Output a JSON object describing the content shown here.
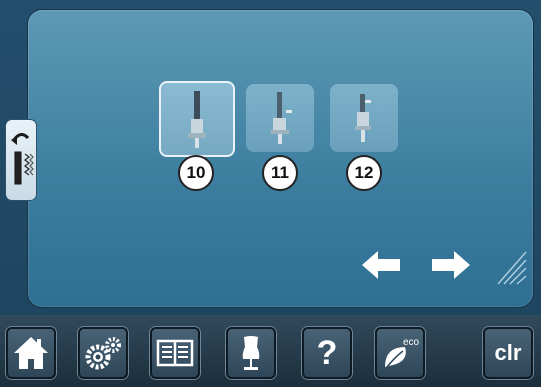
{
  "presser_feet": [
    {
      "number": "10",
      "selected": true
    },
    {
      "number": "11",
      "selected": false
    },
    {
      "number": "12",
      "selected": false
    }
  ],
  "side_tab": {
    "icon": "presser-foot-selection-icon"
  },
  "navigation": {
    "prev_icon": "arrow-left-icon",
    "next_icon": "arrow-right-icon"
  },
  "toolbar": {
    "home_icon": "home-icon",
    "setup_icon": "gears-icon",
    "tutorial_icon": "book-icon",
    "consultant_icon": "dress-form-icon",
    "help_icon": "question-icon",
    "eco_icon": "eco-leaf-icon",
    "eco_label": "eco",
    "help_label": "?",
    "clr_label": "clr"
  },
  "colors": {
    "panel": "#4a8bab",
    "selected_border": "#e8f2f8",
    "bar": "#2a4050"
  }
}
